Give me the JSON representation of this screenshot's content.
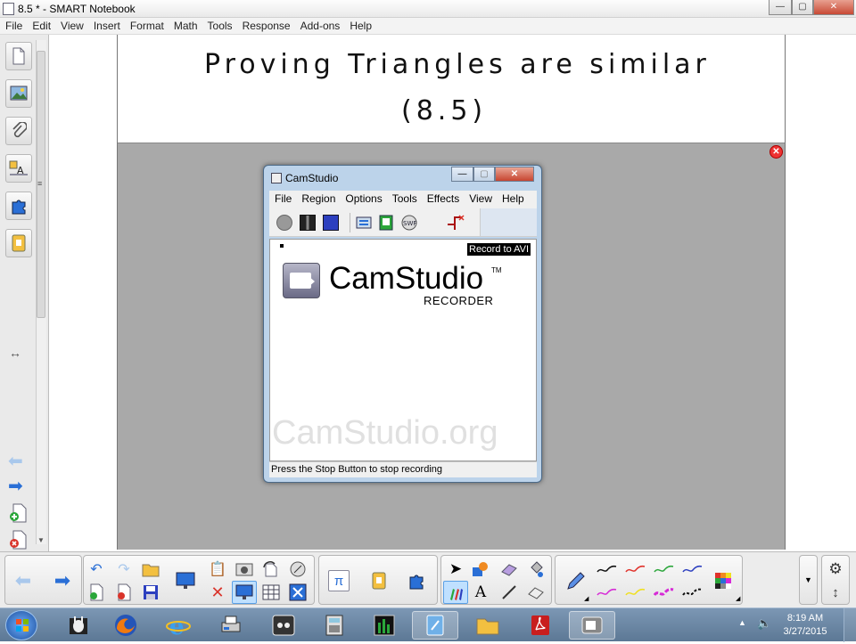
{
  "window": {
    "title": "8.5 * - SMART Notebook",
    "minimize": "—",
    "maximize": "▢",
    "close": "✕"
  },
  "menu": [
    "File",
    "Edit",
    "View",
    "Insert",
    "Format",
    "Math",
    "Tools",
    "Response",
    "Add-ons",
    "Help"
  ],
  "page": {
    "line1": "Proving Triangles are similar",
    "line2": "(8.5)"
  },
  "camstudio": {
    "title": "CamStudio",
    "menu": [
      "File",
      "Region",
      "Options",
      "Tools",
      "Effects",
      "View",
      "Help"
    ],
    "tooltip": "Record to AVI",
    "logo_text": "CamStudio",
    "logo_tm": "TM",
    "logo_sub": "RECORDER",
    "watermark": "CamStudio.org",
    "status": "Press the Stop Button to stop recording"
  },
  "taskbar": {
    "time": "8:19 AM",
    "date": "3/27/2015"
  },
  "colors": {
    "accent_blue": "#2a6fd6",
    "close_red": "#d9342b",
    "pen_black": "#111111",
    "pen_red": "#e0312a",
    "pen_green": "#2aa63a",
    "pen_blue": "#2c3fbf",
    "pen_magenta": "#d62ad6",
    "pen_yellow": "#f0e020"
  }
}
